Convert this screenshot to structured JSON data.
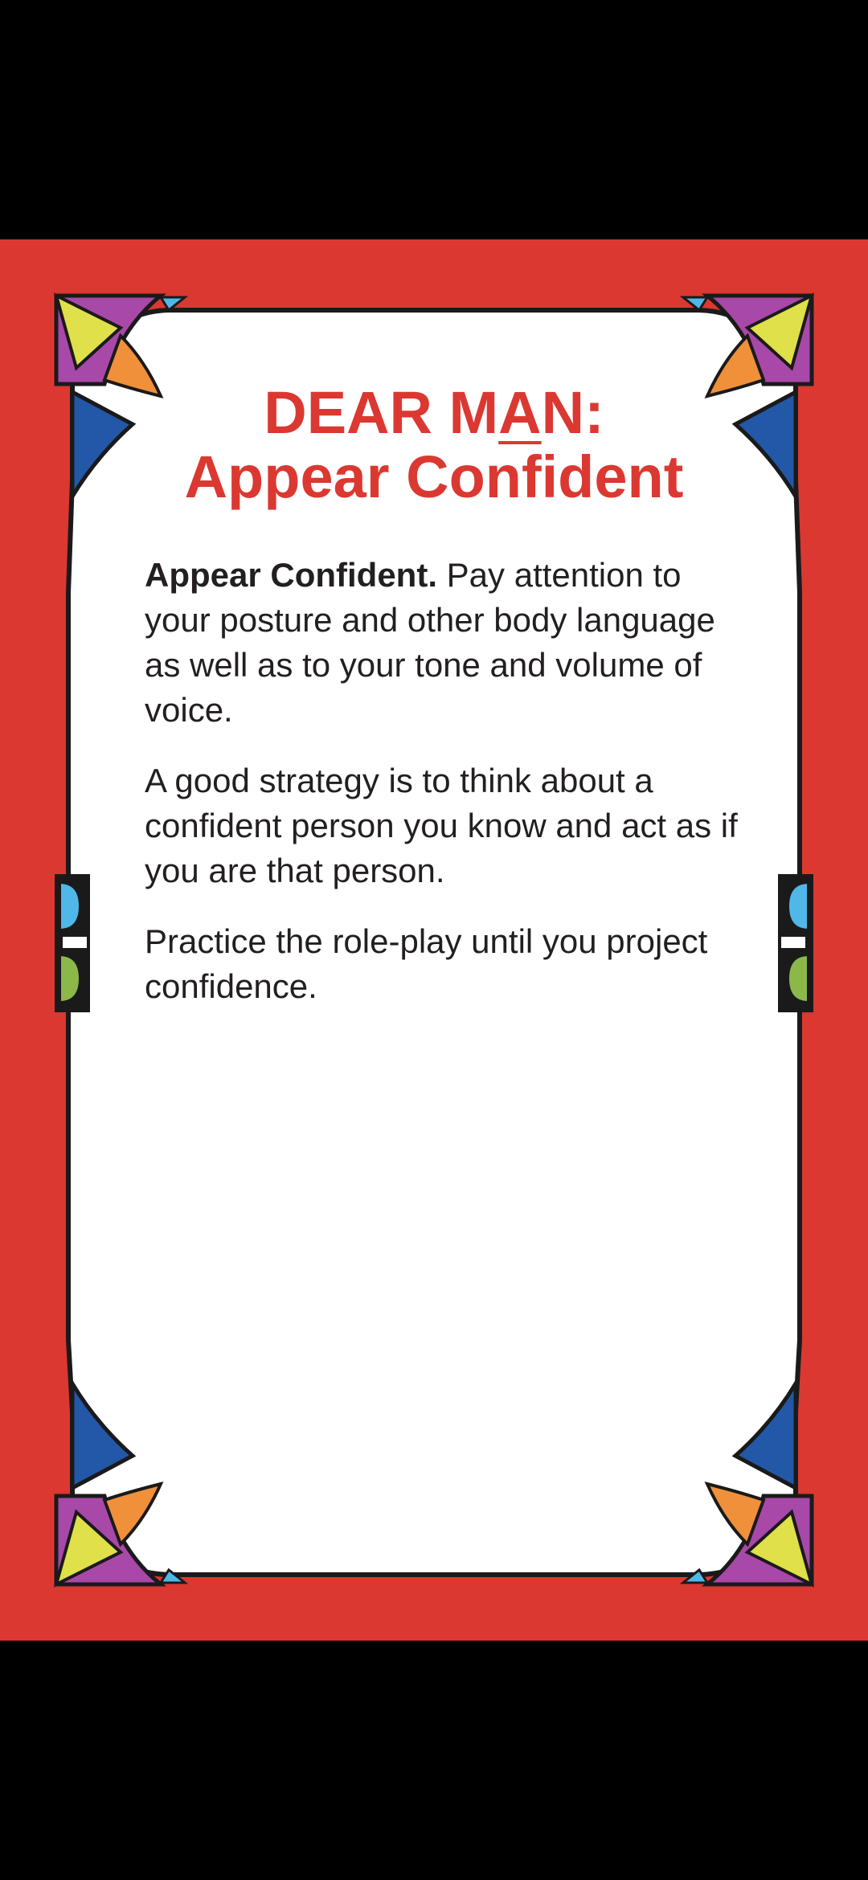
{
  "card": {
    "title_part1": "DEAR M",
    "title_underlined": "A",
    "title_part2": "N:",
    "title_line2": "Appear Confident",
    "paragraph1_bold": "Appear Confident.",
    "paragraph1_text": " Pay attention to your posture and other body language as well as to your tone and volume of voice.",
    "paragraph2": "A good strategy is to think about a confident person you know and act as if you are that person.",
    "paragraph3": "Practice the role-play until you project confidence."
  },
  "colors": {
    "background": "#000000",
    "card_red": "#db3832",
    "title_red": "#db3832",
    "text": "#231f20",
    "ornament_yellow": "#dfe04a",
    "ornament_purple": "#a848a8",
    "ornament_orange": "#f0903a",
    "ornament_green": "#8cb84a",
    "ornament_blue": "#2358a8",
    "ornament_lightblue": "#4fb8e8"
  }
}
